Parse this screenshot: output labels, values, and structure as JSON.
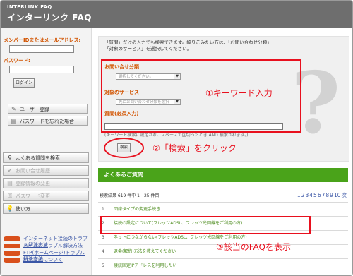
{
  "header": {
    "brand_small": "INTERLINK FAQ",
    "title": "インターリンク FAQ"
  },
  "login": {
    "id_label": "メンバーIDまたはメールアドレス:",
    "password_label": "パスワード:",
    "login_button": "ログイン"
  },
  "account_buttons": {
    "register": "ユーザー登録",
    "forgot_password": "パスワードを忘れた場合"
  },
  "nav": {
    "search_faq": "よくある質問を検索",
    "inquiry_history": "お問い合せ履歴",
    "change_registration": "登録情報の変更",
    "change_password": "パスワード変更",
    "how_to_use": "使い方"
  },
  "faq_links": [
    "インターネット接続のトラブル解決方法",
    "メールのトラブル解決方法",
    "FTP(ホームページ)トラブル解決方法",
    "料金案内について"
  ],
  "search": {
    "help_text": "「質問」だけの入力でも検索できます。絞りこみたい方は、「お問い合わせ分類」「対象のサービス」を選択してください。",
    "category_label": "お問い合せ分類",
    "category_value": "選択してください。",
    "service_label": "対象のサービス",
    "service_value": "先にお問い合わせ分類を選択",
    "question_label": "質問(必須入力)",
    "question_value": "",
    "below_text": "(キーワード検索に設定され、スペースで区切ったとき AND 検索されます。)",
    "search_button": "検索"
  },
  "annotations": {
    "step1": "①キーワード入力",
    "step2": "②「検索」をクリック",
    "step3": "③該当のFAQを表示"
  },
  "results": {
    "heading": "よくあるご質問",
    "count_text": "検索結果 619 件中 1 - 25 件目",
    "pages": [
      "1",
      "2",
      "3",
      "4",
      "5",
      "6",
      "7",
      "8",
      "9",
      "10",
      "次"
    ],
    "rows": [
      {
        "num": "1",
        "text": "回線タイプの変更手続き"
      },
      {
        "num": "2",
        "text": "接続の設定について(フレッツADSL、フレッツ光回線をご利用の方)"
      },
      {
        "num": "3",
        "text": "ネットにつながらない(フレッツADSL、フレッツ光回線をご利用の方)"
      },
      {
        "num": "4",
        "text": "退会(解約)方法を教えてください"
      },
      {
        "num": "5",
        "text": "接続固定IPアドレスを利用したい"
      }
    ]
  },
  "colors": {
    "header": "#6e6e6e",
    "accent_green": "#4aa31a",
    "label_orange": "#d25400",
    "annotation_red": "#e8101e"
  }
}
